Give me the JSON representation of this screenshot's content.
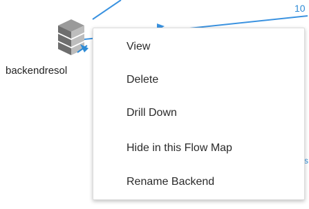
{
  "flow_map": {
    "node": {
      "label": "backendresol",
      "icon": "server-stack-icon"
    },
    "edge_labels": [
      "10",
      "s"
    ],
    "colors": {
      "link": "#3a92e0",
      "accent": "#2e8bd6"
    }
  },
  "context_menu": {
    "items": [
      {
        "label": "View"
      },
      {
        "label": "Delete"
      },
      {
        "label": "Drill Down"
      },
      {
        "label": "Hide in this Flow Map"
      },
      {
        "label": "Rename Backend"
      }
    ]
  }
}
